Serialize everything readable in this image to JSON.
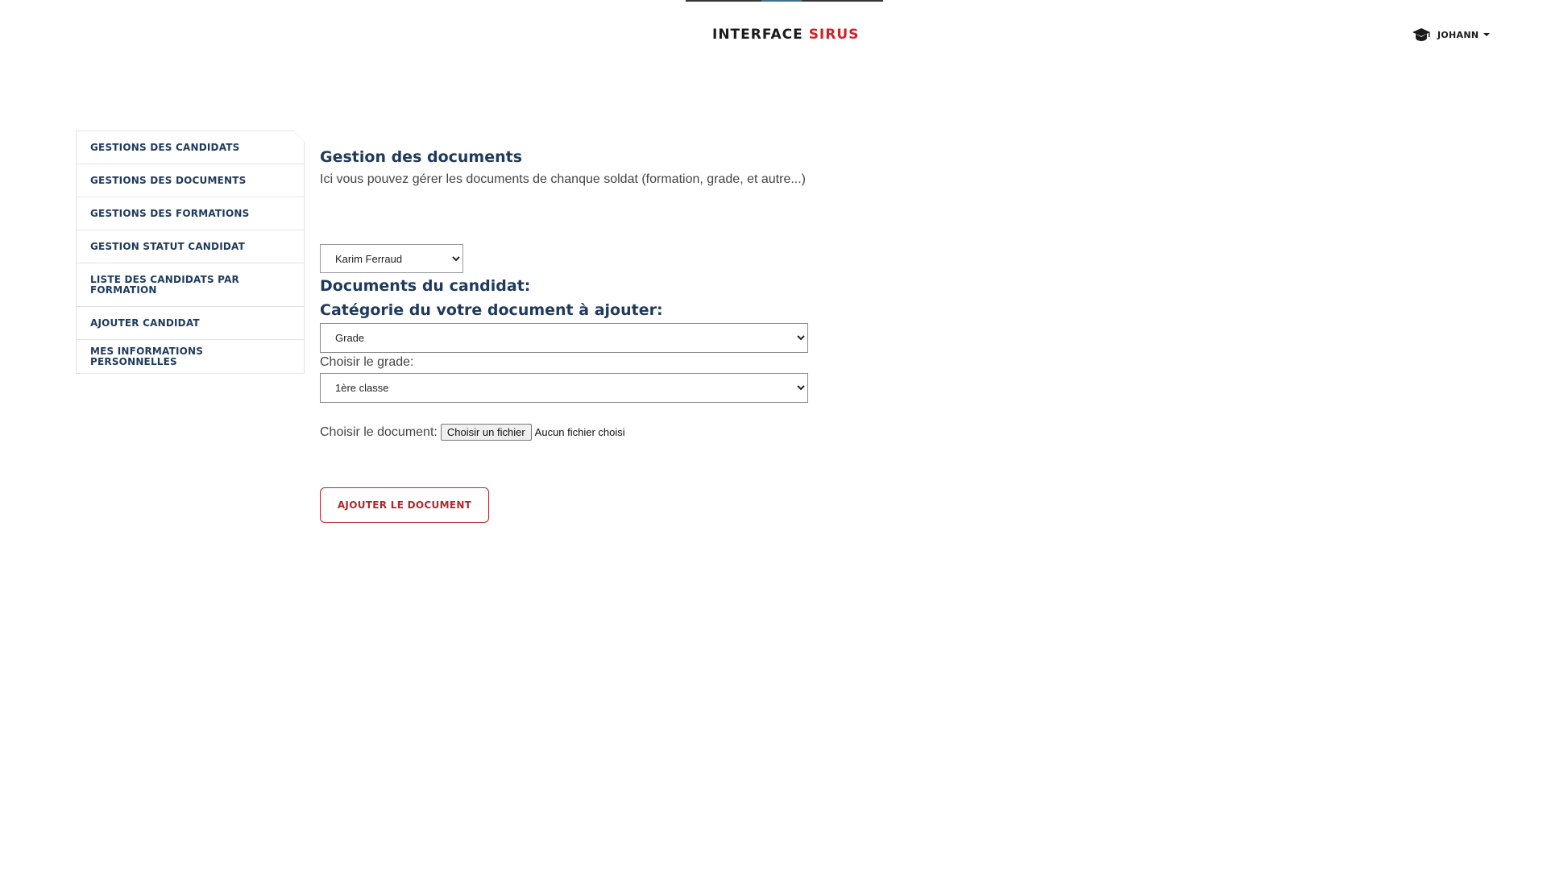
{
  "brand": {
    "part1": "INTERFACE ",
    "part2": "SIRUS"
  },
  "user": {
    "name": "JOHANN",
    "icon": "graduation-cap-icon"
  },
  "sidebar": {
    "items": [
      {
        "label": "GESTIONS DES CANDIDATS"
      },
      {
        "label": "GESTIONS DES DOCUMENTS"
      },
      {
        "label": "GESTIONS DES FORMATIONS"
      },
      {
        "label": "GESTION STATUT CANDIDAT"
      },
      {
        "label": "LISTE DES CANDIDATS PAR FORMATION"
      },
      {
        "label": "AJOUTER CANDIDAT"
      },
      {
        "label": "MES INFORMATIONS PERSONNELLES"
      }
    ]
  },
  "main": {
    "title": "Gestion des documents",
    "description": "Ici vous pouvez gérer les documents de chanque soldat (formation, grade, et autre...)",
    "candidate_select": {
      "value": "Karim Ferraud"
    },
    "documents_title": "Documents du candidat:",
    "category_title": "Catégorie du votre document à ajouter:",
    "category_select": {
      "value": "Grade"
    },
    "grade_label": "Choisir le grade:",
    "grade_select": {
      "value": "1ère classe"
    },
    "document_label": "Choisir le document:",
    "file_button_label": "Choisir un fichier",
    "file_status": "Aucun fichier choisi",
    "submit_label": "AJOUTER LE DOCUMENT"
  },
  "colors": {
    "navy": "#1e3a5c",
    "brand_red": "#d42027",
    "button_red": "#b3262b"
  }
}
